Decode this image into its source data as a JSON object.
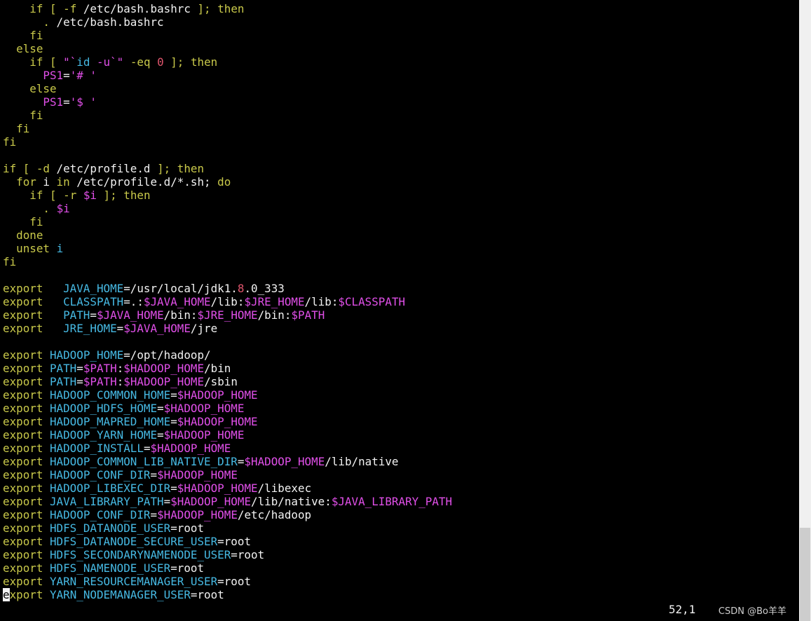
{
  "colors": {
    "background": "#000000",
    "text": "#f2f2f2",
    "keyword": "#c9c94a",
    "identifier": "#46b9e3",
    "variable": "#e04fe8",
    "number": "#e0556d",
    "cursor": "#f2f2f2"
  },
  "editor": {
    "lines": [
      [
        {
          "t": "    "
        },
        {
          "t": "if",
          "c": "keyword"
        },
        {
          "t": " [ ",
          "c": "keyword"
        },
        {
          "t": "-f",
          "c": "keyword"
        },
        {
          "t": " /etc/bash.bashrc "
        },
        {
          "t": "];",
          "c": "keyword"
        },
        {
          "t": " "
        },
        {
          "t": "then",
          "c": "keyword"
        }
      ],
      [
        {
          "t": "      "
        },
        {
          "t": ".",
          "c": "keyword"
        },
        {
          "t": " /etc/bash.bashrc"
        }
      ],
      [
        {
          "t": "    "
        },
        {
          "t": "fi",
          "c": "keyword"
        }
      ],
      [
        {
          "t": "  "
        },
        {
          "t": "else",
          "c": "keyword"
        }
      ],
      [
        {
          "t": "    "
        },
        {
          "t": "if",
          "c": "keyword"
        },
        {
          "t": " [ ",
          "c": "keyword"
        },
        {
          "t": "\"`",
          "c": "variable"
        },
        {
          "t": "id",
          "c": "identifier"
        },
        {
          "t": " -u",
          "c": "variable"
        },
        {
          "t": "`\"",
          "c": "variable"
        },
        {
          "t": " -eq ",
          "c": "keyword"
        },
        {
          "t": "0",
          "c": "number"
        },
        {
          "t": " ];",
          "c": "keyword"
        },
        {
          "t": " "
        },
        {
          "t": "then",
          "c": "keyword"
        }
      ],
      [
        {
          "t": "      "
        },
        {
          "t": "PS1",
          "c": "variable"
        },
        {
          "t": "="
        },
        {
          "t": "'# '",
          "c": "variable"
        }
      ],
      [
        {
          "t": "    "
        },
        {
          "t": "else",
          "c": "keyword"
        }
      ],
      [
        {
          "t": "      "
        },
        {
          "t": "PS1",
          "c": "variable"
        },
        {
          "t": "="
        },
        {
          "t": "'$ '",
          "c": "variable"
        }
      ],
      [
        {
          "t": "    "
        },
        {
          "t": "fi",
          "c": "keyword"
        }
      ],
      [
        {
          "t": "  "
        },
        {
          "t": "fi",
          "c": "keyword"
        }
      ],
      [
        {
          "t": "fi",
          "c": "keyword"
        }
      ],
      [
        {
          "t": ""
        }
      ],
      [
        {
          "t": "if",
          "c": "keyword"
        },
        {
          "t": " [ ",
          "c": "keyword"
        },
        {
          "t": "-d",
          "c": "keyword"
        },
        {
          "t": " /etc/profile.d "
        },
        {
          "t": "];",
          "c": "keyword"
        },
        {
          "t": " "
        },
        {
          "t": "then",
          "c": "keyword"
        }
      ],
      [
        {
          "t": "  "
        },
        {
          "t": "for",
          "c": "keyword"
        },
        {
          "t": " i "
        },
        {
          "t": "in",
          "c": "keyword"
        },
        {
          "t": " /etc/profile.d/*.sh; "
        },
        {
          "t": "do",
          "c": "keyword"
        }
      ],
      [
        {
          "t": "    "
        },
        {
          "t": "if",
          "c": "keyword"
        },
        {
          "t": " [ ",
          "c": "keyword"
        },
        {
          "t": "-r",
          "c": "keyword"
        },
        {
          "t": " "
        },
        {
          "t": "$i",
          "c": "variable"
        },
        {
          "t": " ];",
          "c": "keyword"
        },
        {
          "t": " "
        },
        {
          "t": "then",
          "c": "keyword"
        }
      ],
      [
        {
          "t": "      "
        },
        {
          "t": ".",
          "c": "keyword"
        },
        {
          "t": " "
        },
        {
          "t": "$i",
          "c": "variable"
        }
      ],
      [
        {
          "t": "    "
        },
        {
          "t": "fi",
          "c": "keyword"
        }
      ],
      [
        {
          "t": "  "
        },
        {
          "t": "done",
          "c": "keyword"
        }
      ],
      [
        {
          "t": "  "
        },
        {
          "t": "unset",
          "c": "keyword"
        },
        {
          "t": " "
        },
        {
          "t": "i",
          "c": "identifier"
        }
      ],
      [
        {
          "t": "fi",
          "c": "keyword"
        }
      ],
      [
        {
          "t": ""
        }
      ],
      [
        {
          "t": "export",
          "c": "keyword"
        },
        {
          "t": "   "
        },
        {
          "t": "JAVA_HOME",
          "c": "identifier"
        },
        {
          "t": "=/usr/local/jdk1."
        },
        {
          "t": "8",
          "c": "number"
        },
        {
          "t": ".0_333"
        }
      ],
      [
        {
          "t": "export",
          "c": "keyword"
        },
        {
          "t": "   "
        },
        {
          "t": "CLASSPATH",
          "c": "identifier"
        },
        {
          "t": "=.:"
        },
        {
          "t": "$JAVA_HOME",
          "c": "variable"
        },
        {
          "t": "/lib:"
        },
        {
          "t": "$JRE_HOME",
          "c": "variable"
        },
        {
          "t": "/lib:"
        },
        {
          "t": "$CLASSPATH",
          "c": "variable"
        }
      ],
      [
        {
          "t": "export",
          "c": "keyword"
        },
        {
          "t": "   "
        },
        {
          "t": "PATH",
          "c": "identifier"
        },
        {
          "t": "="
        },
        {
          "t": "$JAVA_HOME",
          "c": "variable"
        },
        {
          "t": "/bin:"
        },
        {
          "t": "$JRE_HOME",
          "c": "variable"
        },
        {
          "t": "/bin:"
        },
        {
          "t": "$PATH",
          "c": "variable"
        }
      ],
      [
        {
          "t": "export",
          "c": "keyword"
        },
        {
          "t": "   "
        },
        {
          "t": "JRE_HOME",
          "c": "identifier"
        },
        {
          "t": "="
        },
        {
          "t": "$JAVA_HOME",
          "c": "variable"
        },
        {
          "t": "/jre"
        }
      ],
      [
        {
          "t": ""
        }
      ],
      [
        {
          "t": "export",
          "c": "keyword"
        },
        {
          "t": " "
        },
        {
          "t": "HADOOP_HOME",
          "c": "identifier"
        },
        {
          "t": "=/opt/hadoop/"
        }
      ],
      [
        {
          "t": "export",
          "c": "keyword"
        },
        {
          "t": " "
        },
        {
          "t": "PATH",
          "c": "identifier"
        },
        {
          "t": "="
        },
        {
          "t": "$PATH",
          "c": "variable"
        },
        {
          "t": ":"
        },
        {
          "t": "$HADOOP_HOME",
          "c": "variable"
        },
        {
          "t": "/bin"
        }
      ],
      [
        {
          "t": "export",
          "c": "keyword"
        },
        {
          "t": " "
        },
        {
          "t": "PATH",
          "c": "identifier"
        },
        {
          "t": "="
        },
        {
          "t": "$PATH",
          "c": "variable"
        },
        {
          "t": ":"
        },
        {
          "t": "$HADOOP_HOME",
          "c": "variable"
        },
        {
          "t": "/sbin"
        }
      ],
      [
        {
          "t": "export",
          "c": "keyword"
        },
        {
          "t": " "
        },
        {
          "t": "HADOOP_COMMON_HOME",
          "c": "identifier"
        },
        {
          "t": "="
        },
        {
          "t": "$HADOOP_HOME",
          "c": "variable"
        }
      ],
      [
        {
          "t": "export",
          "c": "keyword"
        },
        {
          "t": " "
        },
        {
          "t": "HADOOP_HDFS_HOME",
          "c": "identifier"
        },
        {
          "t": "="
        },
        {
          "t": "$HADOOP_HOME",
          "c": "variable"
        }
      ],
      [
        {
          "t": "export",
          "c": "keyword"
        },
        {
          "t": " "
        },
        {
          "t": "HADOOP_MAPRED_HOME",
          "c": "identifier"
        },
        {
          "t": "="
        },
        {
          "t": "$HADOOP_HOME",
          "c": "variable"
        }
      ],
      [
        {
          "t": "export",
          "c": "keyword"
        },
        {
          "t": " "
        },
        {
          "t": "HADOOP_YARN_HOME",
          "c": "identifier"
        },
        {
          "t": "="
        },
        {
          "t": "$HADOOP_HOME",
          "c": "variable"
        }
      ],
      [
        {
          "t": "export",
          "c": "keyword"
        },
        {
          "t": " "
        },
        {
          "t": "HADOOP_INSTALL",
          "c": "identifier"
        },
        {
          "t": "="
        },
        {
          "t": "$HADOOP_HOME",
          "c": "variable"
        }
      ],
      [
        {
          "t": "export",
          "c": "keyword"
        },
        {
          "t": " "
        },
        {
          "t": "HADOOP_COMMON_LIB_NATIVE_DIR",
          "c": "identifier"
        },
        {
          "t": "="
        },
        {
          "t": "$HADOOP_HOME",
          "c": "variable"
        },
        {
          "t": "/lib/native"
        }
      ],
      [
        {
          "t": "export",
          "c": "keyword"
        },
        {
          "t": " "
        },
        {
          "t": "HADOOP_CONF_DIR",
          "c": "identifier"
        },
        {
          "t": "="
        },
        {
          "t": "$HADOOP_HOME",
          "c": "variable"
        }
      ],
      [
        {
          "t": "export",
          "c": "keyword"
        },
        {
          "t": " "
        },
        {
          "t": "HADOOP_LIBEXEC_DIR",
          "c": "identifier"
        },
        {
          "t": "="
        },
        {
          "t": "$HADOOP_HOME",
          "c": "variable"
        },
        {
          "t": "/libexec"
        }
      ],
      [
        {
          "t": "export",
          "c": "keyword"
        },
        {
          "t": " "
        },
        {
          "t": "JAVA_LIBRARY_PATH",
          "c": "identifier"
        },
        {
          "t": "="
        },
        {
          "t": "$HADOOP_HOME",
          "c": "variable"
        },
        {
          "t": "/lib/native:"
        },
        {
          "t": "$JAVA_LIBRARY_PATH",
          "c": "variable"
        }
      ],
      [
        {
          "t": "export",
          "c": "keyword"
        },
        {
          "t": " "
        },
        {
          "t": "HADOOP_CONF_DIR",
          "c": "identifier"
        },
        {
          "t": "="
        },
        {
          "t": "$HADOOP_HOME",
          "c": "variable"
        },
        {
          "t": "/etc/hadoop"
        }
      ],
      [
        {
          "t": "export",
          "c": "keyword"
        },
        {
          "t": " "
        },
        {
          "t": "HDFS_DATANODE_USER",
          "c": "identifier"
        },
        {
          "t": "=root"
        }
      ],
      [
        {
          "t": "export",
          "c": "keyword"
        },
        {
          "t": " "
        },
        {
          "t": "HDFS_DATANODE_SECURE_USER",
          "c": "identifier"
        },
        {
          "t": "=root"
        }
      ],
      [
        {
          "t": "export",
          "c": "keyword"
        },
        {
          "t": " "
        },
        {
          "t": "HDFS_SECONDARYNAMENODE_USER",
          "c": "identifier"
        },
        {
          "t": "=root"
        }
      ],
      [
        {
          "t": "export",
          "c": "keyword"
        },
        {
          "t": " "
        },
        {
          "t": "HDFS_NAMENODE_USER",
          "c": "identifier"
        },
        {
          "t": "=root"
        }
      ],
      [
        {
          "t": "export",
          "c": "keyword"
        },
        {
          "t": " "
        },
        {
          "t": "YARN_RESOURCEMANAGER_USER",
          "c": "identifier"
        },
        {
          "t": "=root"
        }
      ],
      [
        {
          "t": "e",
          "c": "cursor"
        },
        {
          "t": "xport",
          "c": "keyword"
        },
        {
          "t": " "
        },
        {
          "t": "YARN_NODEMANAGER_USER",
          "c": "identifier"
        },
        {
          "t": "=root"
        }
      ]
    ]
  },
  "status": {
    "ruler": "52,1"
  },
  "watermark": {
    "text": "CSDN @Bo羊羊"
  },
  "scrollbar": {
    "thumb_start": 0.85,
    "thumb_fraction": 0.15
  }
}
